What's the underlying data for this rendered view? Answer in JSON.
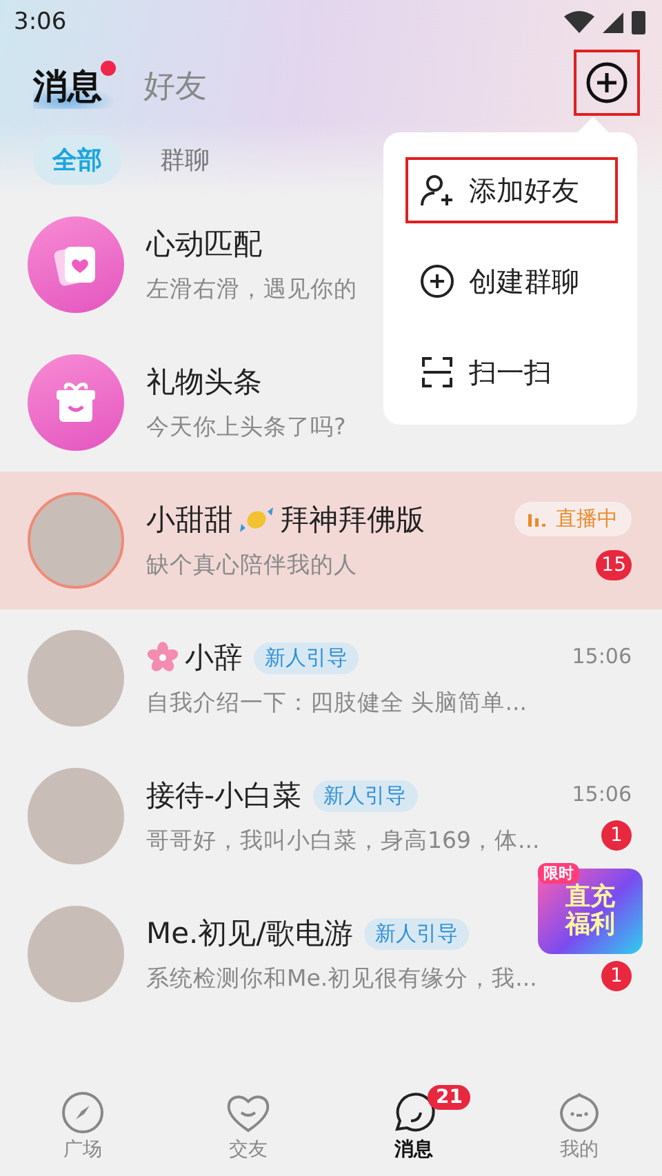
{
  "status_bar": {
    "time": "3:06"
  },
  "header": {
    "tabs": [
      {
        "label": "消息",
        "selected": true,
        "dot": true
      },
      {
        "label": "好友",
        "selected": false,
        "dot": false
      }
    ],
    "add_button": {
      "highlighted": true
    }
  },
  "filters": [
    {
      "label": "全部",
      "selected": true
    },
    {
      "label": "群聊",
      "selected": false
    }
  ],
  "menu": {
    "items": [
      {
        "kind": "add-friend",
        "label": "添加好友",
        "highlighted": true
      },
      {
        "kind": "create-group",
        "label": "创建群聊",
        "highlighted": false
      },
      {
        "kind": "scan",
        "label": "扫一扫",
        "highlighted": false
      }
    ]
  },
  "conversations": [
    {
      "kind": "match",
      "name_parts": [
        "心动匹配"
      ],
      "preview": "左滑右滑，遇见你的",
      "pinned": false
    },
    {
      "kind": "gift",
      "name_parts": [
        "礼物头条"
      ],
      "preview": "今天你上头条了吗?",
      "pinned": false
    },
    {
      "kind": "user",
      "name_parts": [
        "小甜甜",
        "拜神拜佛版"
      ],
      "candy": true,
      "preview": "缺个真心陪伴我的人",
      "live": "直播中",
      "unread": "15",
      "pinned": true
    },
    {
      "kind": "user",
      "flower": true,
      "name_parts": [
        "小辞"
      ],
      "tag": "新人引导",
      "time": "15:06",
      "preview": "自我介绍一下：四肢健全 头脑简单...",
      "pinned": false
    },
    {
      "kind": "user",
      "name_parts": [
        "接待-小白菜"
      ],
      "tag": "新人引导",
      "time": "15:06",
      "preview": "哥哥好，我叫小白菜，身高169，体...",
      "unread": "1",
      "pinned": false
    },
    {
      "kind": "user",
      "name_parts": [
        "Me.初见/歌电游"
      ],
      "tag": "新人引导",
      "preview": "系统检测你和Me.初见很有缘分，我...",
      "unread": "1",
      "pinned": false
    }
  ],
  "promo": {
    "tag": "限时",
    "lines": [
      "直充",
      "福利"
    ]
  },
  "bottom_nav": [
    {
      "kind": "compass",
      "label": "广场",
      "selected": false
    },
    {
      "kind": "heart",
      "label": "交友",
      "selected": false
    },
    {
      "kind": "chat",
      "label": "消息",
      "selected": true,
      "badge": "21"
    },
    {
      "kind": "face",
      "label": "我的",
      "selected": false
    }
  ]
}
